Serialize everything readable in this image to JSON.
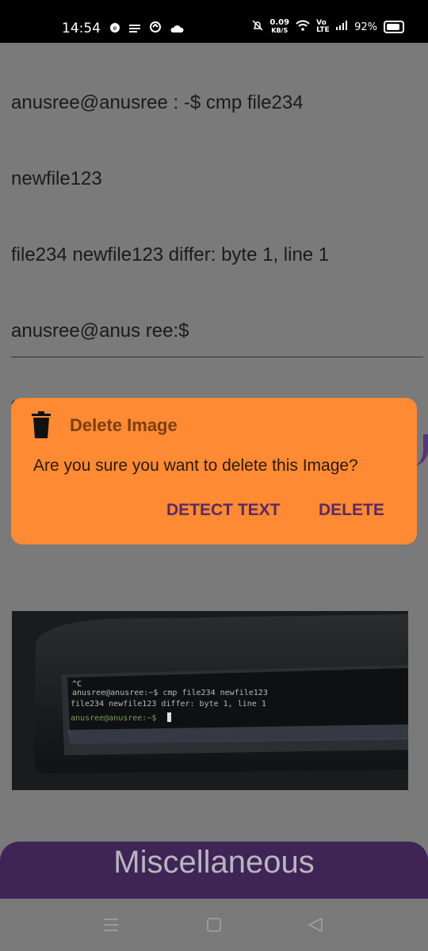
{
  "status_bar": {
    "time": "14:54",
    "network_speed_value": "0.09",
    "network_speed_unit": "KB/S",
    "network_type": "Vo LTE",
    "battery": "92%"
  },
  "ocr_lines": [
    "anusree@anusree : -$ cmp file234",
    "newfile123",
    "file234 newfile123 differ: byte 1, line 1",
    "anusree@anus ree:$",
    "t"
  ],
  "dialog": {
    "icon": "trash-icon",
    "title": "Delete Image",
    "message": "Are you sure you want to delete this Image?",
    "detect_label": "DETECT TEXT",
    "delete_label": "DELETE"
  },
  "photo": {
    "terminal_lines": [
      "^C",
      "anusree@anusree:~$ cmp file234 newfile123",
      "file234 newfile123 differ: byte 1, line 1",
      "anusree@anusree:~$"
    ]
  },
  "misc_bar": {
    "label": "Miscellaneous"
  },
  "colors": {
    "dialog_bg": "#fe8a33",
    "dialog_button": "#5b2a63",
    "misc_bg": "#3f2456",
    "overlay": "#7a7a7a"
  }
}
